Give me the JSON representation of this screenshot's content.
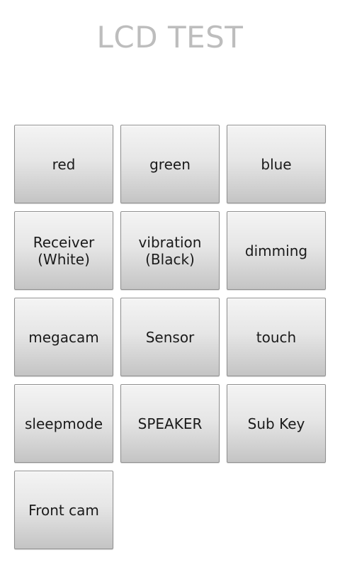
{
  "title": "LCD TEST",
  "buttons": [
    "red",
    "green",
    "blue",
    "Receiver\n(White)",
    "vibration\n(Black)",
    "dimming",
    "megacam",
    "Sensor",
    "touch",
    "sleepmode",
    "SPEAKER",
    "Sub Key",
    "Front cam"
  ]
}
